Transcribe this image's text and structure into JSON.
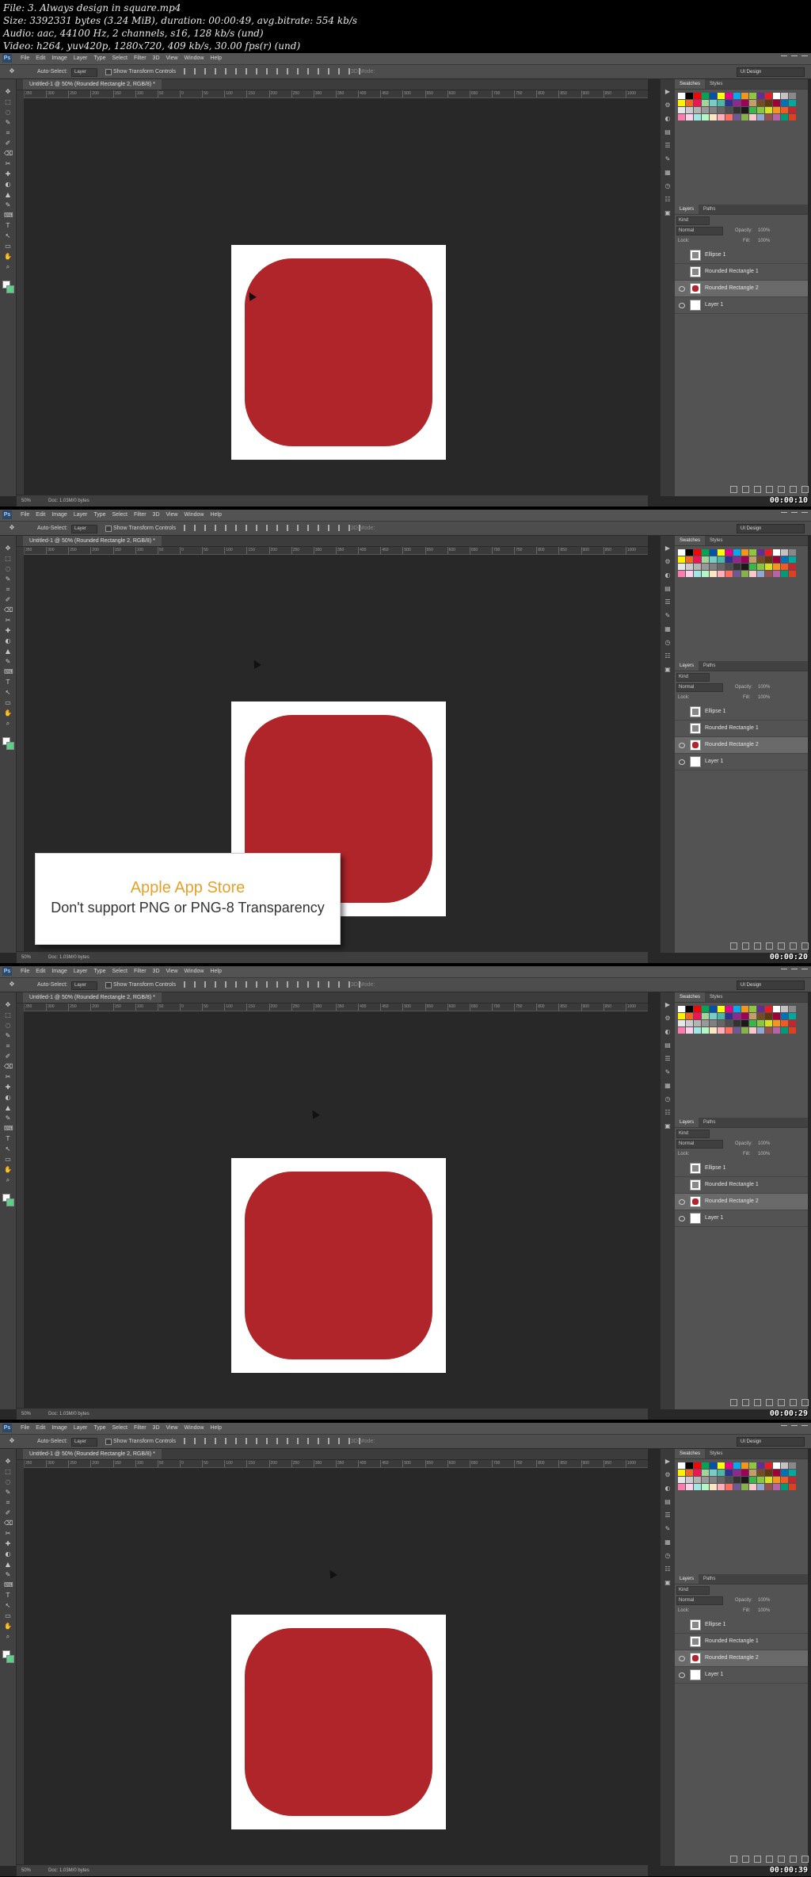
{
  "header": {
    "lines": [
      "File: 3. Always design in square.mp4",
      "Size: 3392331 bytes (3.24 MiB), duration: 00:00:49, avg.bitrate: 554 kb/s",
      "Audio: aac, 44100 Hz, 2 channels, s16, 128 kb/s (und)",
      "Video: h264, yuv420p, 1280x720, 409 kb/s, 30.00 fps(r) (und)"
    ]
  },
  "app": {
    "logo": "Ps",
    "menu": [
      "File",
      "Edit",
      "Image",
      "Layer",
      "Type",
      "Select",
      "Filter",
      "3D",
      "View",
      "Window",
      "Help"
    ],
    "options": {
      "auto_select_label": "Auto-Select:",
      "auto_select_value": "Layer",
      "show_transform_label": "Show Transform Controls",
      "mode_label": "3D Mode:",
      "workspace": "UI Design"
    },
    "doc_tab": "Untitled-1 @ 50% (Rounded Rectangle 2, RGB/8) *",
    "ruler_ticks": [
      "350",
      "300",
      "250",
      "200",
      "150",
      "100",
      "50",
      "0",
      "50",
      "100",
      "150",
      "200",
      "250",
      "300",
      "350",
      "400",
      "450",
      "500",
      "550",
      "600",
      "650",
      "700",
      "750",
      "800",
      "850",
      "900",
      "950",
      "1000"
    ],
    "status": {
      "zoom": "50%",
      "doc": "Doc: 1.03M/0 bytes"
    },
    "panels": {
      "swatch_tabs": [
        "Swatches",
        "Styles"
      ],
      "layer_tabs": [
        "Layers",
        "Paths"
      ],
      "kind": "Kind",
      "blend": "Normal",
      "opacity_label": "Opacity:",
      "opacity_value": "100%",
      "lock_label": "Lock:",
      "fill_label": "Fill:",
      "fill_value": "100%",
      "layers": [
        {
          "name": "Ellipse 1",
          "thumb": "gray",
          "visible": false,
          "selected": false
        },
        {
          "name": "Rounded Rectangle 1",
          "thumb": "gray",
          "visible": false,
          "selected": false
        },
        {
          "name": "Rounded Rectangle 2",
          "thumb": "red",
          "visible": true,
          "selected": true
        },
        {
          "name": "Layer 1",
          "thumb": "white",
          "visible": true,
          "selected": false
        }
      ]
    }
  },
  "swatch_colors": [
    "#ffffff",
    "#000000",
    "#ff0000",
    "#00a651",
    "#0054a6",
    "#ffff00",
    "#ec008c",
    "#00aeef",
    "#f7941d",
    "#8dc63f",
    "#662d91",
    "#ed1c24",
    "#ffffff",
    "#c2c2c2",
    "#898989",
    "#fff200",
    "#f26522",
    "#ed145b",
    "#a3d39c",
    "#7accc8",
    "#4cb6a8",
    "#2e3192",
    "#92278f",
    "#9e005d",
    "#c69c6d",
    "#754c24",
    "#603913",
    "#9e0039",
    "#0072bc",
    "#00a99d",
    "#e6e6e6",
    "#cccccc",
    "#b3b3b3",
    "#999999",
    "#808080",
    "#666666",
    "#4d4d4d",
    "#333333",
    "#1a1a1a",
    "#39b54a",
    "#8cc63f",
    "#d7df23",
    "#f7941d",
    "#f15a24",
    "#c1272d",
    "#ff7bac",
    "#ffd1e8",
    "#a0e7e5",
    "#b4f8c8",
    "#fbe7c6",
    "#ffaebc",
    "#ff6f61",
    "#6b5b95",
    "#88b04b",
    "#f7cac9",
    "#92a8d1",
    "#955251",
    "#b565a7",
    "#009b77",
    "#dd4124"
  ],
  "frames": [
    {
      "timestamp": "00:00:10",
      "cursor": {
        "label": "arrow"
      },
      "callout": false
    },
    {
      "timestamp": "00:00:20",
      "cursor": {
        "label": "arrow"
      },
      "callout": true
    },
    {
      "timestamp": "00:00:29",
      "cursor": {
        "label": "arrow"
      },
      "callout": false
    },
    {
      "timestamp": "00:00:39",
      "cursor": {
        "label": "arrow"
      },
      "callout": false
    }
  ],
  "callout": {
    "title": "Apple App Store",
    "text": "Don't support PNG or PNG-8 Transparency"
  }
}
